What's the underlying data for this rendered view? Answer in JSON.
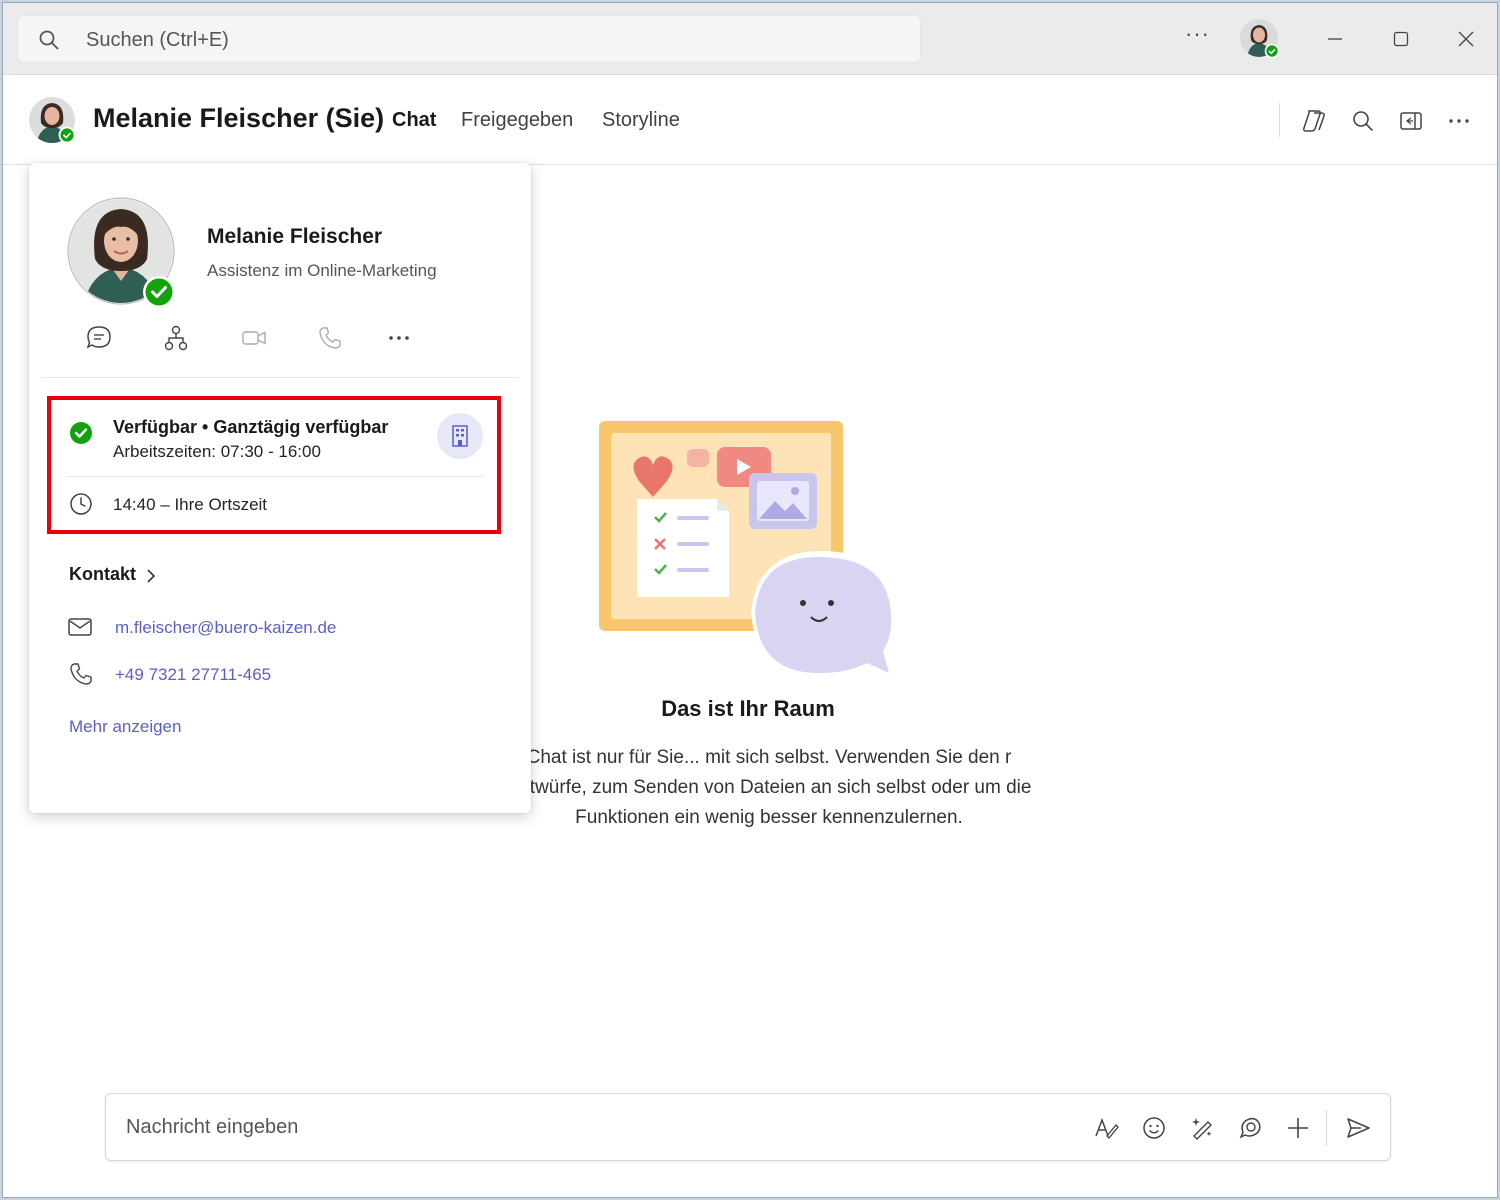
{
  "titlebar": {
    "search_placeholder": "Suchen (Ctrl+E)",
    "more_label": "···"
  },
  "header": {
    "name": "Melanie Fleischer (Sie)",
    "tabs": [
      {
        "label": "Chat",
        "active": true
      },
      {
        "label": "Freigegeben",
        "active": false
      },
      {
        "label": "Storyline",
        "active": false
      }
    ]
  },
  "empty_state": {
    "title": "Das ist Ihr Raum",
    "description": "Chat ist nur für Sie... mit sich selbst. Verwenden Sie den r Entwürfe, zum Senden von Dateien an sich selbst oder um die Funktionen ein wenig besser kennenzulernen."
  },
  "composer": {
    "placeholder": "Nachricht eingeben"
  },
  "profile_card": {
    "name": "Melanie Fleischer",
    "role": "Assistenz im Online-Marketing",
    "actions": [
      "chat-icon",
      "org-chart-icon",
      "video-call-icon",
      "phone-call-icon",
      "more-icon"
    ],
    "status": "Verfügbar • Ganztägig verfügbar",
    "working_hours": "Arbeitszeiten: 07:30 - 16:00",
    "local_time": "14:40 – Ihre Ortszeit",
    "contact_heading": "Kontakt",
    "email": "m.fleischer@buero-kaizen.de",
    "phone": "+49 7321 27711-465",
    "show_more": "Mehr anzeigen"
  },
  "colors": {
    "accent": "#5b5fc7",
    "available": "#13a10e",
    "highlight": "#e8000b"
  }
}
